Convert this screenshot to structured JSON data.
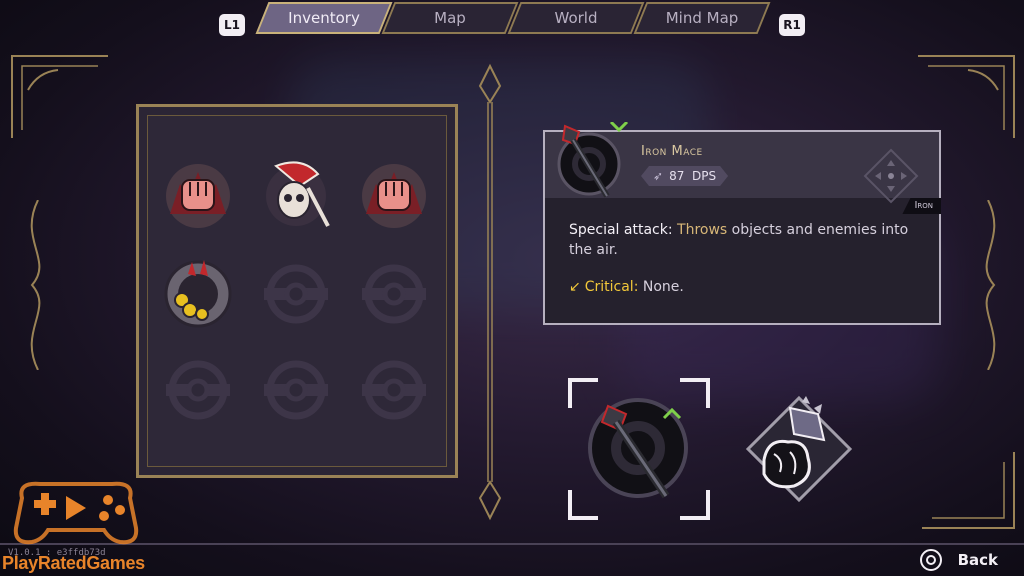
{
  "nav": {
    "left_key": "L1",
    "right_key": "R1",
    "tabs": [
      {
        "label": "Inventory",
        "active": true
      },
      {
        "label": "Map",
        "active": false
      },
      {
        "label": "World",
        "active": false
      },
      {
        "label": "Mind Map",
        "active": false
      }
    ]
  },
  "inventory": {
    "slots": [
      {
        "icon": "fist-gauntlet-icon",
        "filled": true
      },
      {
        "icon": "skull-blade-icon",
        "filled": true
      },
      {
        "icon": "fist-gauntlet-icon",
        "filled": true
      },
      {
        "icon": "spiked-knuckle-icon",
        "filled": true
      },
      {
        "icon": "empty-slot-icon",
        "filled": false
      },
      {
        "icon": "empty-slot-icon",
        "filled": false
      },
      {
        "icon": "empty-slot-icon",
        "filled": false
      },
      {
        "icon": "empty-slot-icon",
        "filled": false
      },
      {
        "icon": "empty-slot-icon",
        "filled": false
      }
    ]
  },
  "detail": {
    "name": "Iron Mace",
    "dps_value": "87",
    "dps_unit": "DPS",
    "tag": "Iron",
    "special_label": "Special attack:",
    "special_highlight": "Throws",
    "special_rest": "objects and enemies into the air.",
    "critical_label": "Critical:",
    "critical_value": "None."
  },
  "equipped": {
    "selected_icon": "iron-mace-icon",
    "secondary_icon": "gauntlet-crystal-icon"
  },
  "footer": {
    "version": "V1.0.1 : e3ffdb73d",
    "back_label": "Back",
    "watermark": "PlayRatedGames"
  },
  "colors": {
    "gold_trim": "#9a8356",
    "tab_active": "#6e6584",
    "highlight_text": "#d8b778",
    "crit_yellow": "#f2c83a",
    "watermark_orange": "#e8842a",
    "upgrade_green": "#7fd04a"
  }
}
